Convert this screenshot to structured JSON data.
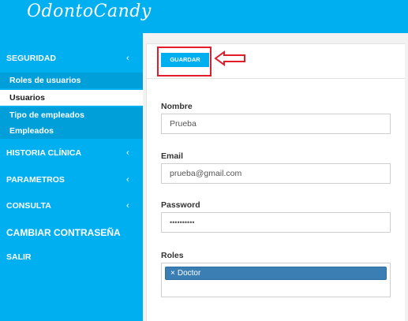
{
  "app": {
    "logo": "OdontoCandy"
  },
  "sidebar": {
    "security": {
      "label": "SEGURIDAD",
      "chevron": "‹"
    },
    "security_items": [
      {
        "label": "Roles de usuarios"
      },
      {
        "label": "Usuarios"
      },
      {
        "label": "Tipo de empleados"
      },
      {
        "label": "Empleados"
      }
    ],
    "items": [
      {
        "label": "HISTORIA CLÍNICA",
        "chevron": "‹"
      },
      {
        "label": "PARAMETROS",
        "chevron": "‹"
      },
      {
        "label": "CONSULTA",
        "chevron": "‹"
      },
      {
        "label": "CAMBIAR CONTRASEÑA"
      },
      {
        "label": "SALIR"
      }
    ]
  },
  "toolbar": {
    "save_label": "GUARDAR"
  },
  "form": {
    "name": {
      "label": "Nombre",
      "value": "Prueba"
    },
    "email": {
      "label": "Email",
      "value": "prueba@gmail.com"
    },
    "password": {
      "label": "Password",
      "value": "••••••••••"
    },
    "roles": {
      "label": "Roles",
      "tags": [
        {
          "remove": "×",
          "label": "Doctor"
        }
      ]
    }
  },
  "colors": {
    "brand": "#00aff0",
    "highlight": "#e21c2a",
    "tag": "#3b7eb4"
  }
}
